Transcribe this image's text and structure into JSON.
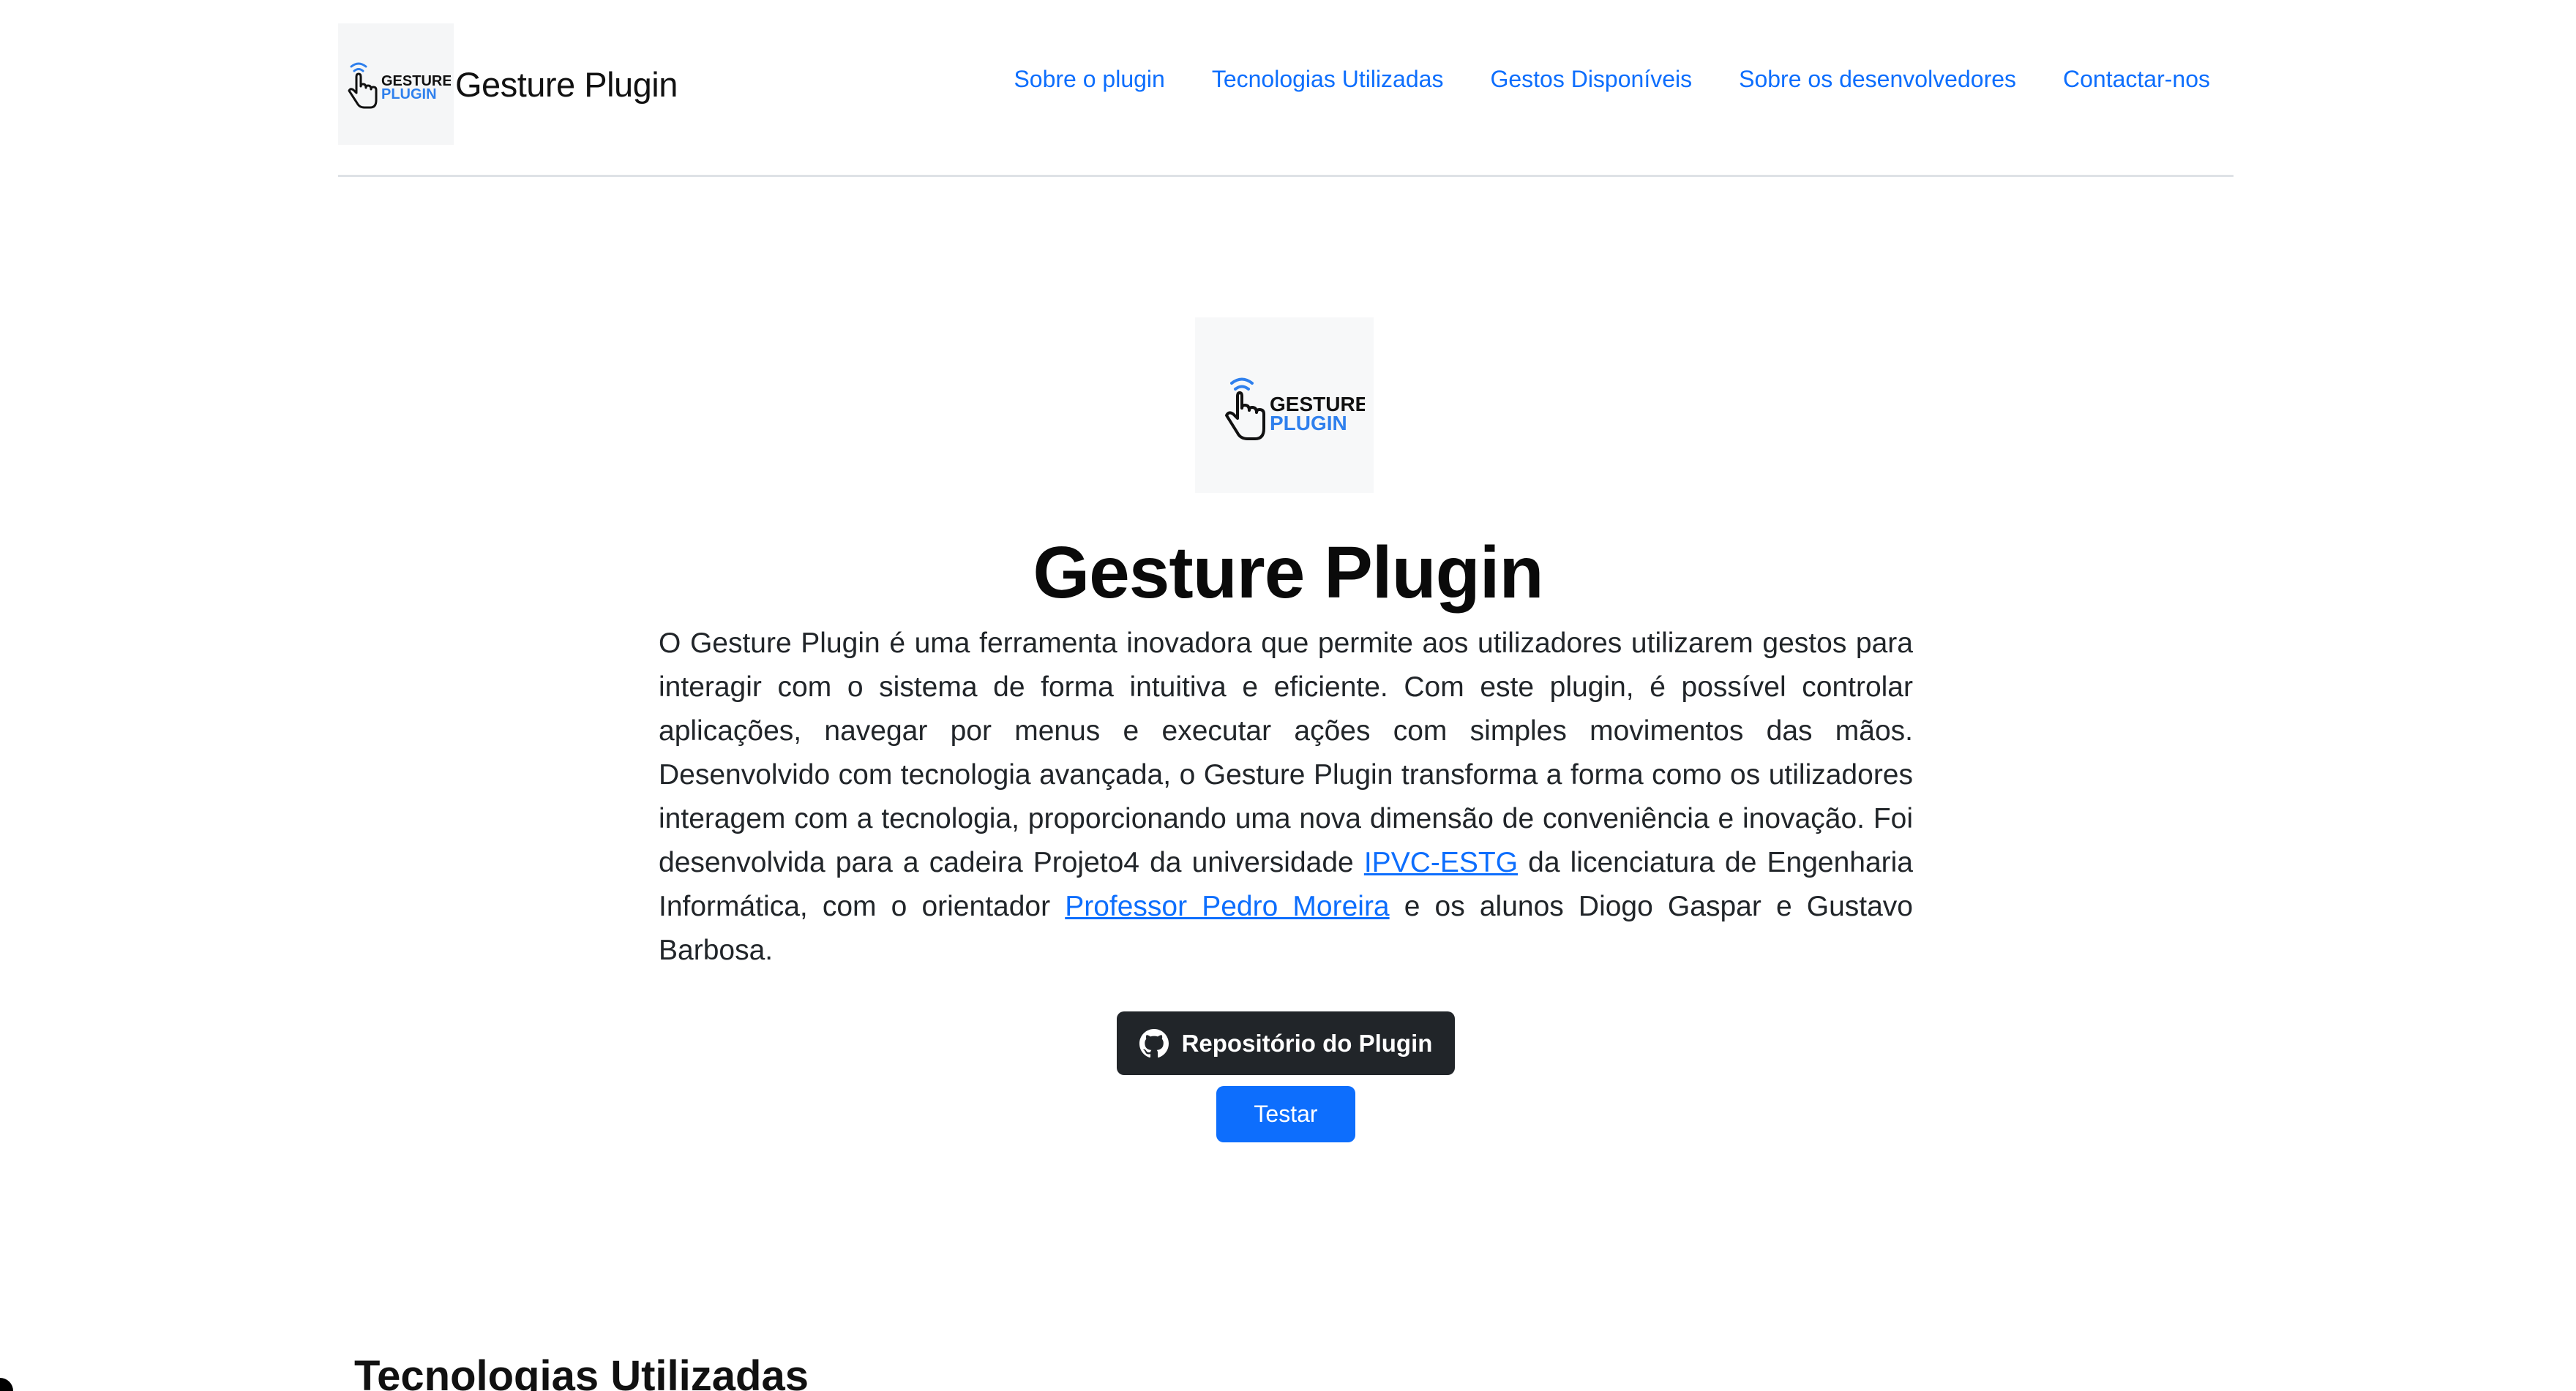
{
  "header": {
    "brand_name": "Gesture Plugin",
    "logo_text_top": "GESTURE",
    "logo_text_bottom": "PLUGIN",
    "nav": [
      {
        "label": "Sobre o plugin"
      },
      {
        "label": "Tecnologias Utilizadas"
      },
      {
        "label": "Gestos Disponíveis"
      },
      {
        "label": "Sobre os desenvolvedores"
      },
      {
        "label": "Contactar-nos"
      }
    ]
  },
  "hero": {
    "logo_text_top": "GESTURE",
    "logo_text_bottom": "PLUGIN",
    "title": "Gesture Plugin",
    "paragraph_part1": "O Gesture Plugin é uma ferramenta inovadora que permite aos utilizadores utilizarem gestos para interagir com o sistema de forma intuitiva e eficiente. Com este plugin, é possível controlar aplicações, navegar por menus e executar ações com simples movimentos das mãos. Desenvolvido com tecnologia avançada, o Gesture Plugin transforma a forma como os utilizadores interagem com a tecnologia, proporcionando uma nova dimensão de conveniência e inovação. Foi desenvolvida para a cadeira Projeto4 da universidade ",
    "link_university": "IPVC-ESTG",
    "paragraph_part2": " da licenciatura de Engenharia Informática, com o orientador ",
    "link_professor": "Professor Pedro Moreira",
    "paragraph_part3": " e os alunos Diogo Gaspar e Gustavo Barbosa.",
    "repo_button": "Repositório do Plugin",
    "test_button": "Testar"
  },
  "next_section": {
    "title": "Tecnologias Utilizadas"
  },
  "colors": {
    "link": "#0d6efd",
    "dark_button": "#212529",
    "primary_button": "#0d6efd",
    "logo_blue": "#2f80ed"
  },
  "icons": {
    "logo": "hand-pointer-gesture-icon",
    "repo": "github-icon"
  }
}
